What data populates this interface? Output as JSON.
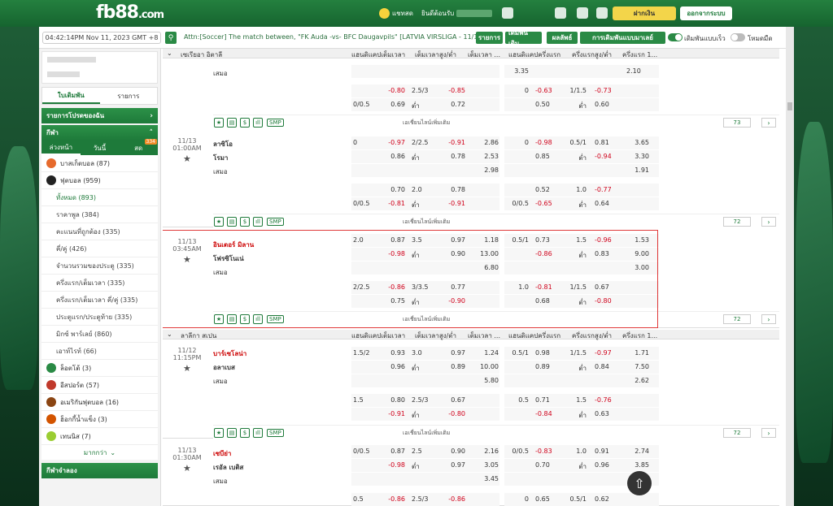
{
  "brand": {
    "logo": "fb88",
    "logo_suffix": ".com"
  },
  "topbar": {
    "chat": "แชทสด",
    "welcome": "ยินดีต้อนรับ",
    "deposit": "ฝากเงิน",
    "logout": "ออกจากระบบ"
  },
  "infobar": {
    "clock": "04:42:14PM Nov 11, 2023 GMT +8",
    "ticker": "Attn:[Soccer] The match between, \"FK Auda -vs- BFC Daugavpils\" [LATVIA VIRSLIGA - 11/11]",
    "tabs": [
      "รายการ",
      "เดิมพันเดิม",
      "ผลลัพธ์",
      "การเดิมพันแบบมาเลย์"
    ],
    "quick_bet": "เดิมพันแบบเร็ว",
    "classic": "โหมดมืด"
  },
  "sidebar": {
    "tabs": [
      "ใบเดิมพัน",
      "รายการ"
    ],
    "fav": "รายการโปรดของฉัน",
    "sports": "กีฬา",
    "subtabs": [
      "ล่วงหน้า",
      "วันนี้",
      "สด"
    ],
    "live_badge": "334",
    "items": [
      {
        "label": "บาสเก็ตบอล (87)",
        "color": "#e66a2c"
      },
      {
        "label": "ฟุตบอล (959)",
        "color": "#222"
      }
    ],
    "football_sub": [
      "ทั้งหมด (893)",
      "ราคาพูล (384)",
      "คะแนนที่ถูกต้อง (335)",
      "คี่/คู่ (426)",
      "จำนวนรวมของประตู (335)",
      "ครึ่งแรก/เต็มเวลา (335)",
      "ครึ่งแรก/เต็มเวลา คี่/คู่ (335)",
      "ประตูแรก/ประตูท้าย (335)",
      "มิกซ์ พาร์เลย์ (860)",
      "เอาท์ไรท์ (66)"
    ],
    "others": [
      {
        "label": "ล็อตโต้ (3)",
        "color": "#2a8a45"
      },
      {
        "label": "อีสปอร์ต (57)",
        "color": "#c0392b"
      },
      {
        "label": "อเมริกันฟุตบอล (16)",
        "color": "#8b4513"
      },
      {
        "label": "ฮ็อกกี้น้ำแข็ง (3)",
        "color": "#d35400"
      },
      {
        "label": "เทนนิส (7)",
        "color": "#9acd32"
      }
    ],
    "more": "มากกว่า",
    "virtual": "กีฬาจำลอง"
  },
  "headers": {
    "ft_hdp": "แฮนดิแคปเต็มเวลา",
    "ft_ou": "เต็มเวลาสูง/ต่ำ",
    "ft_1x2": "เต็มเวลา ...",
    "h1_hdp": "แฮนดิแคปครึ่งแรก",
    "h1_ou": "ครึ่งแรกสูง/ต่ำ",
    "h1_1x2": "ครึ่งแรก 1..."
  },
  "league1": "เซเรียอา อิตาลี",
  "league2": "ลาลีกา สเปน",
  "common": {
    "draw": "เสมอ",
    "low": "ต่ำ",
    "more_bets": "เอเชี่ยนไลน์เพิ่มเติม",
    "smp": "SMP"
  },
  "matches": [
    {
      "date": "",
      "time": "",
      "home": "",
      "away": "",
      "count": "73",
      "l1": [
        "",
        "",
        "",
        "",
        "",
        "3.35",
        "",
        "",
        "",
        "",
        "2.10"
      ],
      "l2": [
        "",
        "-0.80",
        "2.5/3",
        "-0.85",
        "",
        "0",
        "-0.63",
        "1/1.5",
        "-0.73",
        ""
      ],
      "l3": [
        "0/0.5",
        "0.69",
        "ต่ำ",
        "0.72",
        "",
        "",
        "0.50",
        "ต่ำ",
        "0.60",
        ""
      ]
    },
    {
      "date": "11/13",
      "time": "01:00AM",
      "home": "ลาซิโอ",
      "away": "โรมา",
      "count": "72",
      "l1": [
        "0",
        "-0.97",
        "2/2.5",
        "-0.91",
        "2.86",
        "0",
        "-0.98",
        "0.5/1",
        "0.81",
        "3.65"
      ],
      "l1b": [
        "",
        "0.86",
        "ต่ำ",
        "0.78",
        "2.53",
        "",
        "0.85",
        "ต่ำ",
        "-0.94",
        "3.30"
      ],
      "l1c": [
        "",
        "",
        "",
        "",
        "2.98",
        "",
        "",
        "",
        "",
        "1.91"
      ],
      "l2": [
        "",
        "0.70",
        "2.0",
        "0.78",
        "",
        "",
        "0.52",
        "1.0",
        "-0.77",
        ""
      ],
      "l3": [
        "0/0.5",
        "-0.81",
        "ต่ำ",
        "-0.91",
        "",
        "0/0.5",
        "-0.65",
        "ต่ำ",
        "0.64",
        ""
      ]
    },
    {
      "date": "11/13",
      "time": "03:45AM",
      "home": "อินเตอร์ มิลาน",
      "away": "โฟรซิโนเน่",
      "count": "72",
      "l1": [
        "2.0",
        "0.87",
        "3.5",
        "0.97",
        "1.18",
        "0.5/1",
        "0.73",
        "1.5",
        "-0.96",
        "1.53"
      ],
      "l1b": [
        "",
        "-0.98",
        "ต่ำ",
        "0.90",
        "13.00",
        "",
        "-0.86",
        "ต่ำ",
        "0.83",
        "9.00"
      ],
      "l1c": [
        "",
        "",
        "",
        "",
        "6.80",
        "",
        "",
        "",
        "",
        "3.00"
      ],
      "l2": [
        "2/2.5",
        "-0.86",
        "3/3.5",
        "0.77",
        "",
        "1.0",
        "-0.81",
        "1/1.5",
        "0.67",
        ""
      ],
      "l3": [
        "",
        "0.75",
        "ต่ำ",
        "-0.90",
        "",
        "",
        "0.68",
        "ต่ำ",
        "-0.80",
        ""
      ]
    },
    {
      "date": "11/12",
      "time": "11:15PM",
      "home": "บาร์เซโลน่า",
      "away": "อลาเบส",
      "count": "72",
      "l1": [
        "1.5/2",
        "0.93",
        "3.0",
        "0.97",
        "1.24",
        "0.5/1",
        "0.98",
        "1/1.5",
        "-0.97",
        "1.71"
      ],
      "l1b": [
        "",
        "0.96",
        "ต่ำ",
        "0.89",
        "10.00",
        "",
        "0.89",
        "ต่ำ",
        "0.84",
        "7.50"
      ],
      "l1c": [
        "",
        "",
        "",
        "",
        "5.80",
        "",
        "",
        "",
        "",
        "2.62"
      ],
      "l2": [
        "1.5",
        "0.80",
        "2.5/3",
        "0.67",
        "",
        "0.5",
        "0.71",
        "1.5",
        "-0.76",
        ""
      ],
      "l3": [
        "",
        "-0.91",
        "ต่ำ",
        "-0.80",
        "",
        "",
        "-0.84",
        "ต่ำ",
        "0.63",
        ""
      ]
    },
    {
      "date": "11/13",
      "time": "01:30AM",
      "home": "เซบีย่า",
      "away": "เรอัล เบติส",
      "count": "",
      "l1": [
        "0/0.5",
        "0.87",
        "2.5",
        "0.90",
        "2.16",
        "0/0.5",
        "-0.83",
        "1.0",
        "0.91",
        "2.74"
      ],
      "l1b": [
        "",
        "-0.98",
        "ต่ำ",
        "0.97",
        "3.05",
        "",
        "0.70",
        "ต่ำ",
        "0.96",
        "3.85"
      ],
      "l1c": [
        "",
        "",
        "",
        "",
        "3.45",
        "",
        "",
        "",
        "",
        ""
      ],
      "l2": [
        "0.5",
        "-0.86",
        "2.5/3",
        "-0.86",
        "",
        "0",
        "0.65",
        "0.5/1",
        "0.62",
        ""
      ]
    }
  ]
}
